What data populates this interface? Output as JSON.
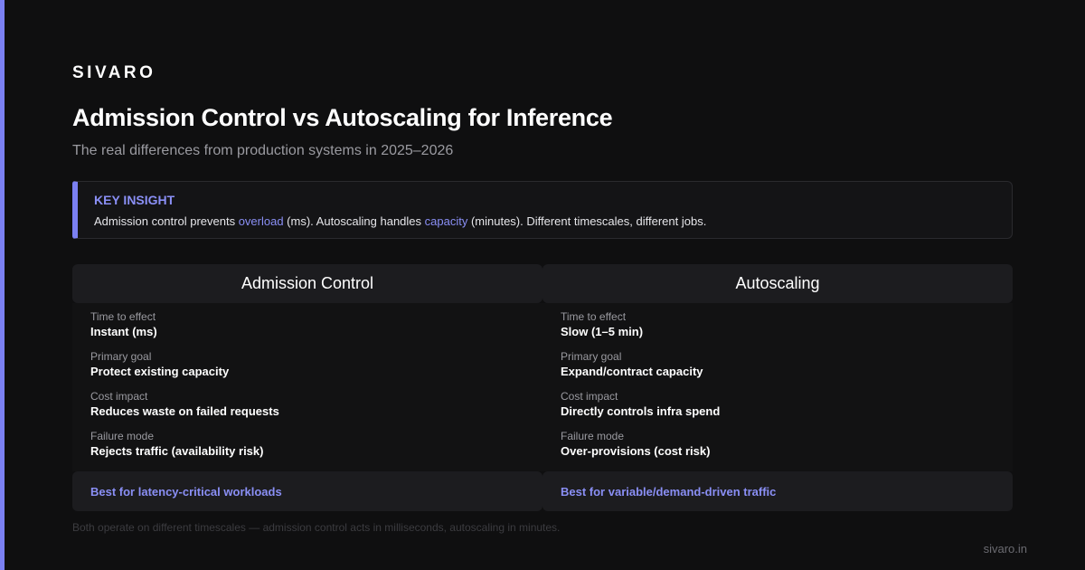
{
  "brand": "SIVARO",
  "title": "Admission Control vs Autoscaling for Inference",
  "subtitle": "The real differences from production systems in 2025–2026",
  "insight": {
    "label": "KEY INSIGHT",
    "text_1": "Admission control prevents ",
    "hl_1": "overload",
    "text_2": " (ms). Autoscaling handles ",
    "hl_2": "capacity",
    "text_3": " (minutes). Different timescales, different jobs."
  },
  "columns": [
    {
      "title": "Admission Control",
      "rows": [
        {
          "label": "Time to effect",
          "value": "Instant (ms)"
        },
        {
          "label": "Primary goal",
          "value": "Protect existing capacity"
        },
        {
          "label": "Cost impact",
          "value": "Reduces waste on failed requests"
        },
        {
          "label": "Failure mode",
          "value": "Rejects traffic (availability risk)"
        }
      ],
      "best_for": "Best for latency-critical workloads"
    },
    {
      "title": "Autoscaling",
      "rows": [
        {
          "label": "Time to effect",
          "value": "Slow (1–5 min)"
        },
        {
          "label": "Primary goal",
          "value": "Expand/contract capacity"
        },
        {
          "label": "Cost impact",
          "value": "Directly controls infra spend"
        },
        {
          "label": "Failure mode",
          "value": "Over-provisions (cost risk)"
        }
      ],
      "best_for": "Best for variable/demand-driven traffic"
    }
  ],
  "footnote": "Both operate on different timescales — admission control acts in milliseconds, autoscaling in minutes.",
  "site": "sivaro.in",
  "colors": {
    "accent": "#7b80f2",
    "background": "#0f0f10",
    "highlight": "#8a8ff5"
  }
}
